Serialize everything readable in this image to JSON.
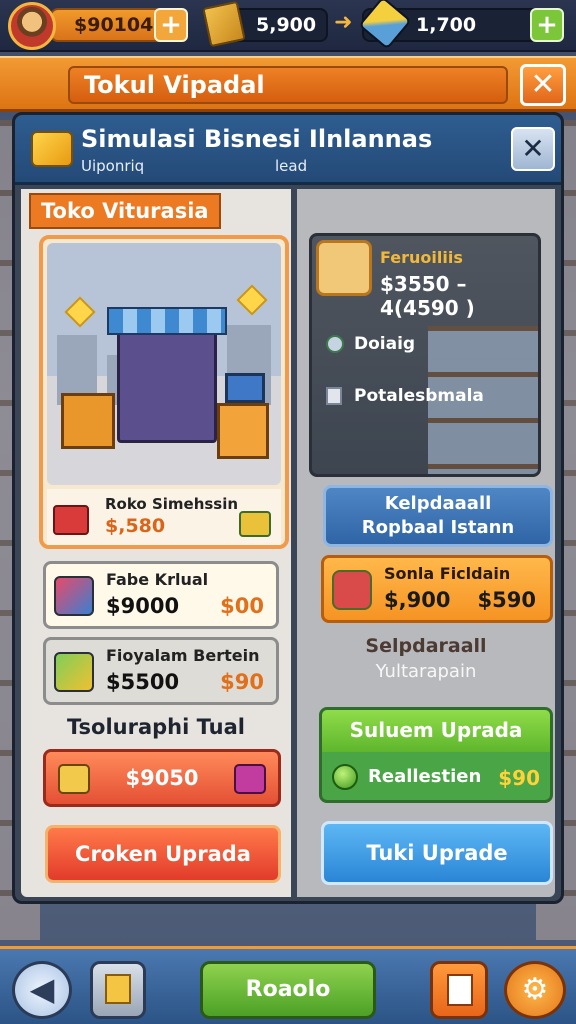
{
  "topbar": {
    "coins": "$90104",
    "crates": "5,900",
    "tools": "1,700",
    "add_left": "+",
    "add_right": "+"
  },
  "header": {
    "title": "Tokul Vipadal",
    "close": "✕"
  },
  "panel": {
    "title": "Simulasi Bisnesi Ilnlannas",
    "sub_left": "Uiponriq",
    "sub_right": "lead",
    "tool": "✕"
  },
  "left": {
    "tag": "Toko Viturasia",
    "shop": {
      "name": "Roko Simehssin",
      "price": "$,580"
    },
    "items": [
      {
        "name": "Fabe Krlual",
        "price": "$9000",
        "cost": "$00"
      },
      {
        "name": "Fioyalam Bertein",
        "price": "$5500",
        "cost": "$90"
      }
    ],
    "section_label": "Tsoluraphi Tual",
    "price_button": "$9050",
    "upgrade_button": "Croken Uprada"
  },
  "right": {
    "product": {
      "name": "Feruoiliis",
      "price": "$3550 – 4(4590 )"
    },
    "options": [
      "Doiaig",
      "Potalesbmala"
    ],
    "blue_button": {
      "line1": "Kelpdaaall",
      "line2": "Ropbaal Istann"
    },
    "orange_card": {
      "name": "Sonla Ficldain",
      "price": "$,900",
      "cost": "$590"
    },
    "label1": "Selpdaraall",
    "label2": "Yultarapain",
    "green": {
      "title": "Suluem Uprada",
      "label": "Reallestien",
      "cost": "$90"
    },
    "upgrade_button": "Tuki Uprade"
  },
  "bottombar": {
    "back": "◀",
    "main": "Roaolo",
    "settings": "⚙"
  },
  "colors": {
    "accent_orange": "#f29a35",
    "panel_blue": "#2e5d90",
    "button_green": "#4ca126",
    "button_blue": "#2a86d6",
    "button_red": "#e23b2b"
  }
}
